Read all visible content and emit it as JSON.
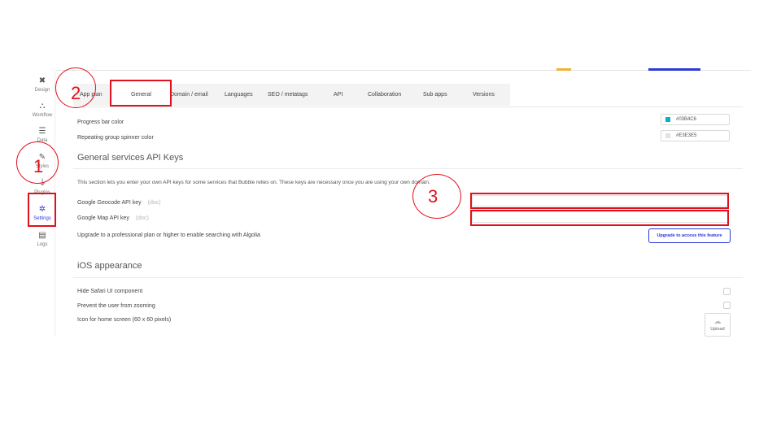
{
  "header": {
    "accent_colors": [
      "#f0b330",
      "#2b39d6"
    ]
  },
  "sidebar": {
    "items": [
      {
        "label": "Design",
        "icon": "design-icon",
        "glyph": "✖"
      },
      {
        "label": "Workflow",
        "icon": "workflow-icon",
        "glyph": "⛬"
      },
      {
        "label": "Data",
        "icon": "data-icon",
        "glyph": "☰"
      },
      {
        "label": "Styles",
        "icon": "brush-icon",
        "glyph": "✎"
      },
      {
        "label": "Plugins",
        "icon": "plug-icon",
        "glyph": "⏚"
      },
      {
        "label": "Settings",
        "icon": "gear-icon",
        "glyph": "✲"
      },
      {
        "label": "Logs",
        "icon": "document-icon",
        "glyph": "▤"
      }
    ]
  },
  "tabs": [
    "App plan",
    "General",
    "Domain / email",
    "Languages",
    "SEO / metatags",
    "API",
    "Collaboration",
    "Sub apps",
    "Versions"
  ],
  "active_tab": "General",
  "appearance": {
    "progress_bar_label": "Progress bar color",
    "progress_bar_value": "#03B4C6",
    "spinner_label": "Repeating group spinner color",
    "spinner_value": "#E3E3E5"
  },
  "api_keys": {
    "title": "General services API Keys",
    "description": "This section lets you enter your own API keys for some services that Bubble relies on. These keys are necessary once you are using your own domain.",
    "geocode_label": "Google Geocode API key",
    "map_label": "Google Map API key",
    "doc_link": "(doc)",
    "algolia_label": "Upgrade to a professional plan or higher to enable searching with Algolia",
    "upgrade_button": "Upgrade to access this feature"
  },
  "ios": {
    "title": "iOS appearance",
    "hide_safari_label": "Hide Safari UI component",
    "prevent_zoom_label": "Prevent the user from zooming",
    "icon_label": "Icon for home screen (60 x 60 pixels)",
    "upload_button": "Upload"
  },
  "annotations": {
    "one": "1",
    "two": "2",
    "three": "3",
    "color": "#e0111c"
  }
}
